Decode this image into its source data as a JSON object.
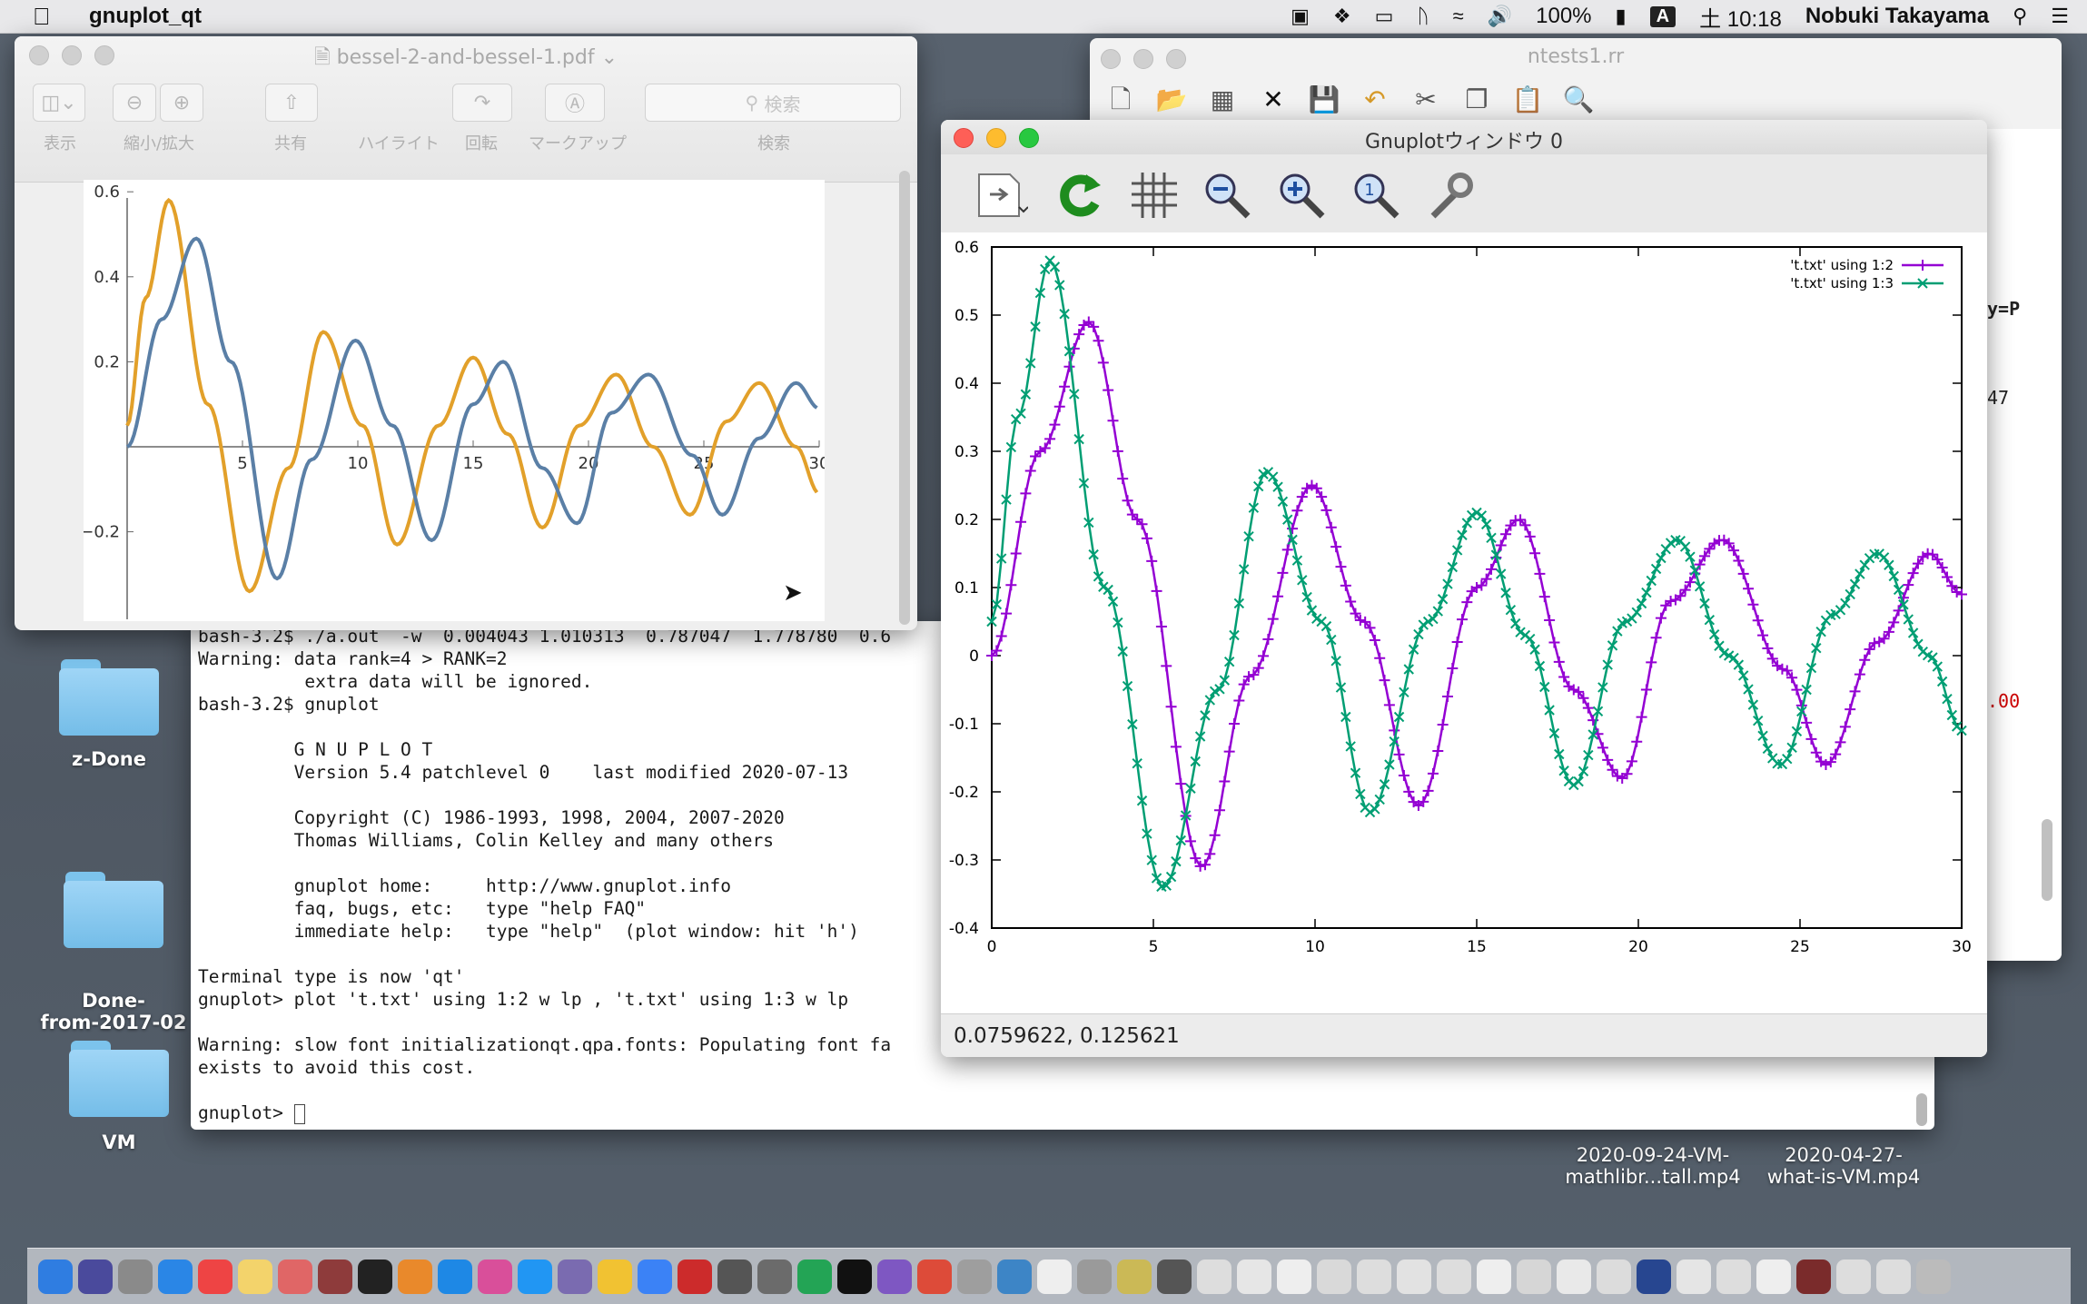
{
  "menubar": {
    "app_name": "gnuplot_qt",
    "battery": "100%",
    "input_indicator": "A",
    "clock": "土 10:18",
    "user": "Nobuki Takayama"
  },
  "preview": {
    "title": "bessel-2-and-bessel-1.pdf",
    "toolbar_labels": [
      "表示",
      "縮小/拡大",
      "共有",
      "ハイライト",
      "回転",
      "マークアップ",
      "検索"
    ],
    "search_placeholder": "検索",
    "plot": {
      "x_ticks": [
        "5",
        "10",
        "15",
        "20",
        "25",
        "30"
      ],
      "y_ticks": [
        "0.6",
        "0.4",
        "0.2",
        "−0.2"
      ],
      "series_colors": [
        "#e2a02a",
        "#5a7fa6"
      ]
    }
  },
  "ntests": {
    "title": "ntests1.rr",
    "side_text": [
      "y=P",
      "47",
      ".00"
    ]
  },
  "terminal": {
    "lines": [
      "bash-3.2$ ./a.out  -w  0.004043 1.010313  0.787047  1.778780  0.6",
      "Warning: data rank=4 > RANK=2",
      "          extra data will be ignored.",
      "bash-3.2$ gnuplot",
      "",
      "         G N U P L O T",
      "         Version 5.4 patchlevel 0    last modified 2020-07-13",
      "",
      "         Copyright (C) 1986-1993, 1998, 2004, 2007-2020",
      "         Thomas Williams, Colin Kelley and many others",
      "",
      "         gnuplot home:     http://www.gnuplot.info",
      "         faq, bugs, etc:   type \"help FAQ\"",
      "         immediate help:   type \"help\"  (plot window: hit 'h')",
      "",
      "Terminal type is now 'qt'",
      "gnuplot> plot 't.txt' using 1:2 w lp , 't.txt' using 1:3 w lp",
      "",
      "Warning: slow font initializationqt.qpa.fonts: Populating font fa",
      "exists to avoid this cost.",
      ""
    ],
    "prompt": "gnuplot> "
  },
  "gnuplot": {
    "title": "Gnuplotウィンドウ 0",
    "status": "0.0759622,  0.125621"
  },
  "desktop": {
    "icons": [
      {
        "label": "z-Done"
      },
      {
        "label": "Done-\nfrom-2017-02"
      },
      {
        "label": "VM"
      }
    ],
    "files": [
      "2020-09-24-VM-\nmathlibr...tall.mp4",
      "2020-04-27-\nwhat-is-VM.mp4"
    ]
  },
  "chart_data": [
    {
      "type": "line",
      "title": "",
      "xlabel": "",
      "ylabel": "",
      "xlim": [
        0,
        30
      ],
      "ylim": [
        -0.4,
        0.6
      ],
      "x_ticks": [
        0,
        5,
        10,
        15,
        20,
        25,
        30
      ],
      "y_ticks": [
        -0.4,
        -0.3,
        -0.2,
        -0.1,
        0,
        0.1,
        0.2,
        0.3,
        0.4,
        0.5,
        0.6
      ],
      "legend": "top-right",
      "series": [
        {
          "name": "'t.txt' using 1:2",
          "color": "#9400d3",
          "marker": "+",
          "x": [
            0,
            1.5,
            3.0,
            4.5,
            6.5,
            8.0,
            9.9,
            11.5,
            13.2,
            15.0,
            16.3,
            18.0,
            19.5,
            21.0,
            22.6,
            24.5,
            25.8,
            27.4,
            29.0,
            30.0
          ],
          "y": [
            0,
            0.3,
            0.49,
            0.2,
            -0.31,
            -0.03,
            0.25,
            0.05,
            -0.22,
            0.1,
            0.2,
            -0.05,
            -0.18,
            0.08,
            0.17,
            -0.02,
            -0.16,
            0.02,
            0.15,
            0.09
          ]
        },
        {
          "name": "'t.txt' using 1:3",
          "color": "#009e73",
          "marker": "x",
          "x": [
            0,
            0.8,
            1.8,
            3.5,
            5.3,
            7.0,
            8.5,
            10.2,
            11.7,
            13.5,
            15.0,
            16.5,
            18.0,
            19.6,
            21.2,
            22.8,
            24.4,
            26.0,
            27.4,
            29.0,
            30.0
          ],
          "y": [
            0.05,
            0.35,
            0.58,
            0.1,
            -0.34,
            -0.05,
            0.27,
            0.05,
            -0.23,
            0.05,
            0.21,
            0.03,
            -0.19,
            0.05,
            0.17,
            0.0,
            -0.16,
            0.06,
            0.15,
            0.0,
            -0.11
          ]
        }
      ]
    }
  ]
}
